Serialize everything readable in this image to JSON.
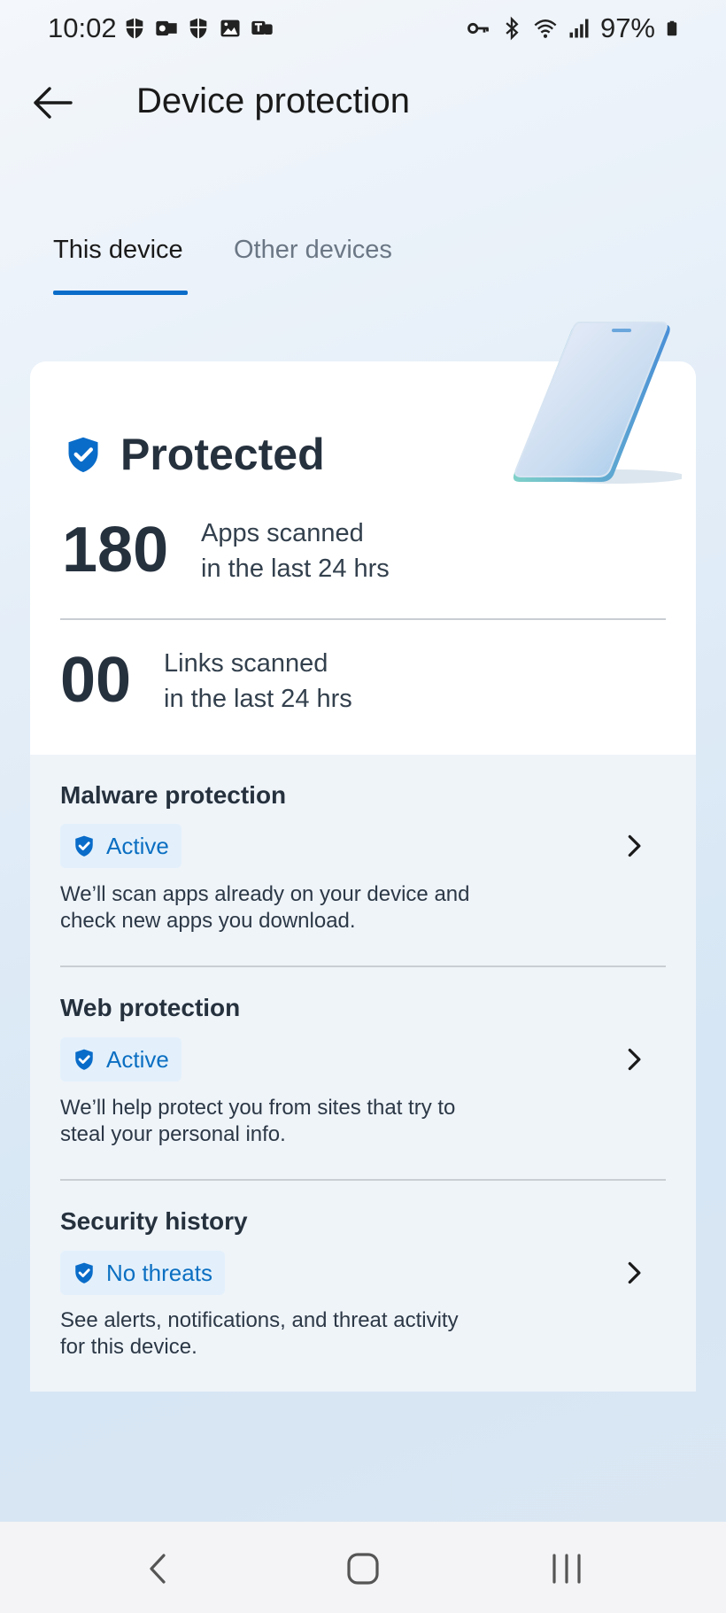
{
  "status_bar": {
    "time": "10:02",
    "battery_percent": "97%",
    "left_icons": [
      "shield-icon",
      "outlook-icon",
      "shield-icon",
      "image-icon",
      "teams-icon"
    ],
    "right_icons": [
      "vpn-key-icon",
      "bluetooth-icon",
      "wifi-icon",
      "signal-icon",
      "battery-icon"
    ]
  },
  "header": {
    "title": "Device protection",
    "back_icon": "back-arrow-icon"
  },
  "tabs": [
    {
      "label": "This device",
      "selected": true
    },
    {
      "label": "Other devices",
      "selected": false
    }
  ],
  "summary": {
    "status": "Protected",
    "apps_count": "180",
    "apps_line1": "Apps scanned",
    "apps_line2": "in the last 24 hrs",
    "links_count": "00",
    "links_line1": "Links scanned",
    "links_line2": "in the last 24 hrs"
  },
  "sections": [
    {
      "title": "Malware protection",
      "badge": "Active",
      "desc1": "We’ll scan apps already on your device and",
      "desc2": "check new apps you download."
    },
    {
      "title": "Web protection",
      "badge": "Active",
      "desc1": "We’ll help protect you from sites that try to",
      "desc2": "steal your personal info."
    },
    {
      "title": "Security history",
      "badge": "No threats",
      "desc1": "See alerts, notifications, and threat activity",
      "desc2": "for this device."
    }
  ],
  "colors": {
    "accent": "#0a6cc9",
    "badge_bg": "#e3f0fb",
    "badge_text": "#0b6fc2",
    "text_dark": "#26313e"
  },
  "nav_bar": {
    "buttons": [
      "back-nav-icon",
      "home-nav-icon",
      "recents-nav-icon"
    ]
  }
}
